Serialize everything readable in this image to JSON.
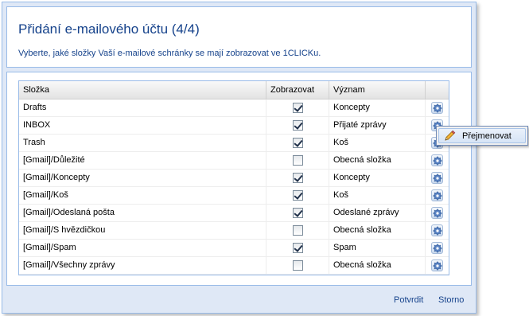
{
  "dialog": {
    "title": "Přidání e-mailového účtu (4/4)",
    "subtitle": "Vyberte, jaké složky Vaší e-mailové schránky se mají zobrazovat ve 1CLICKu."
  },
  "grid": {
    "columns": [
      "Složka",
      "Zobrazovat",
      "Význam",
      ""
    ],
    "rows": [
      {
        "name": "Drafts",
        "show": true,
        "meaning": "Koncepty"
      },
      {
        "name": "INBOX",
        "show": true,
        "meaning": "Přijaté zprávy"
      },
      {
        "name": "Trash",
        "show": true,
        "meaning": "Koš"
      },
      {
        "name": "[Gmail]/Důležité",
        "show": false,
        "meaning": "Obecná složka"
      },
      {
        "name": "[Gmail]/Koncepty",
        "show": true,
        "meaning": "Koncepty"
      },
      {
        "name": "[Gmail]/Koš",
        "show": true,
        "meaning": "Koš"
      },
      {
        "name": "[Gmail]/Odeslaná pošta",
        "show": true,
        "meaning": "Odeslané zprávy"
      },
      {
        "name": "[Gmail]/S hvězdičkou",
        "show": false,
        "meaning": "Obecná složka"
      },
      {
        "name": "[Gmail]/Spam",
        "show": true,
        "meaning": "Spam"
      },
      {
        "name": "[Gmail]/Všechny zprávy",
        "show": false,
        "meaning": "Obecná složka"
      }
    ],
    "row_action_icon": "gear-icon"
  },
  "context_menu": {
    "items": [
      {
        "label": "Přejmenovat",
        "icon": "pencil-icon"
      }
    ]
  },
  "footer": {
    "confirm_label": "Potvrdit",
    "cancel_label": "Storno"
  },
  "colors": {
    "accent": "#15428b",
    "border": "#99bbe8",
    "background": "#dfe8f6"
  }
}
